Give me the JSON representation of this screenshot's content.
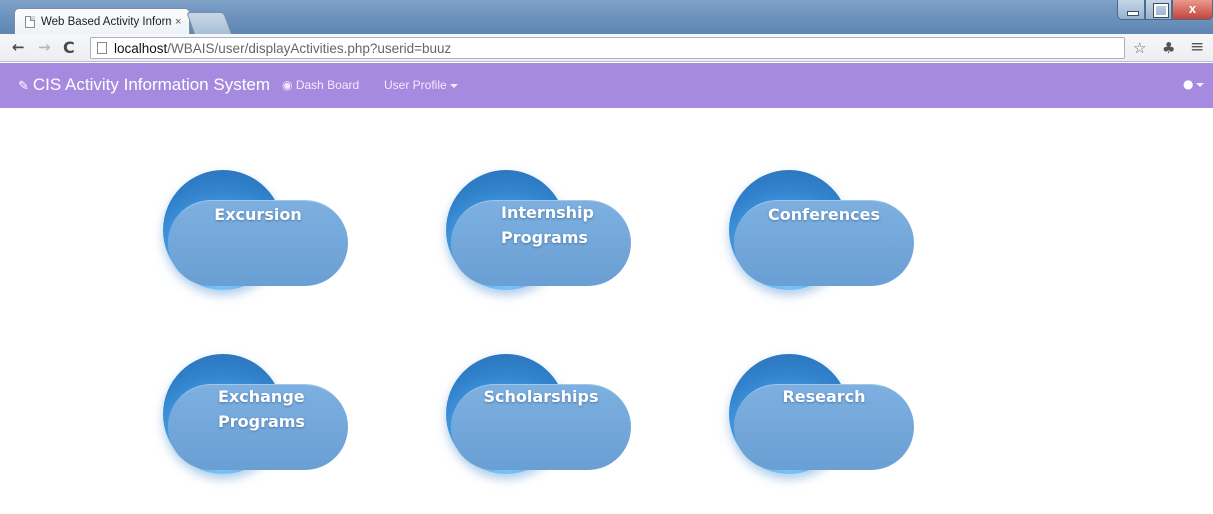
{
  "browser": {
    "tab_title": "Web Based Activity Inform",
    "tab_close": "×",
    "url_host": "localhost",
    "url_path": "/WBAIS/user/displayActivities.php?userid=buuz",
    "close_glyph": "x"
  },
  "navbar": {
    "brand": "CIS Activity Information System",
    "dashboard_label": "Dash Board",
    "profile_label": "User Profile",
    "bg_color": "#a68ae0"
  },
  "activities": [
    {
      "label": "Excursion"
    },
    {
      "label": "Internship Programs"
    },
    {
      "label": "Conferences"
    },
    {
      "label": "Exchange Programs"
    },
    {
      "label": "Scholarships"
    },
    {
      "label": "Research"
    }
  ]
}
